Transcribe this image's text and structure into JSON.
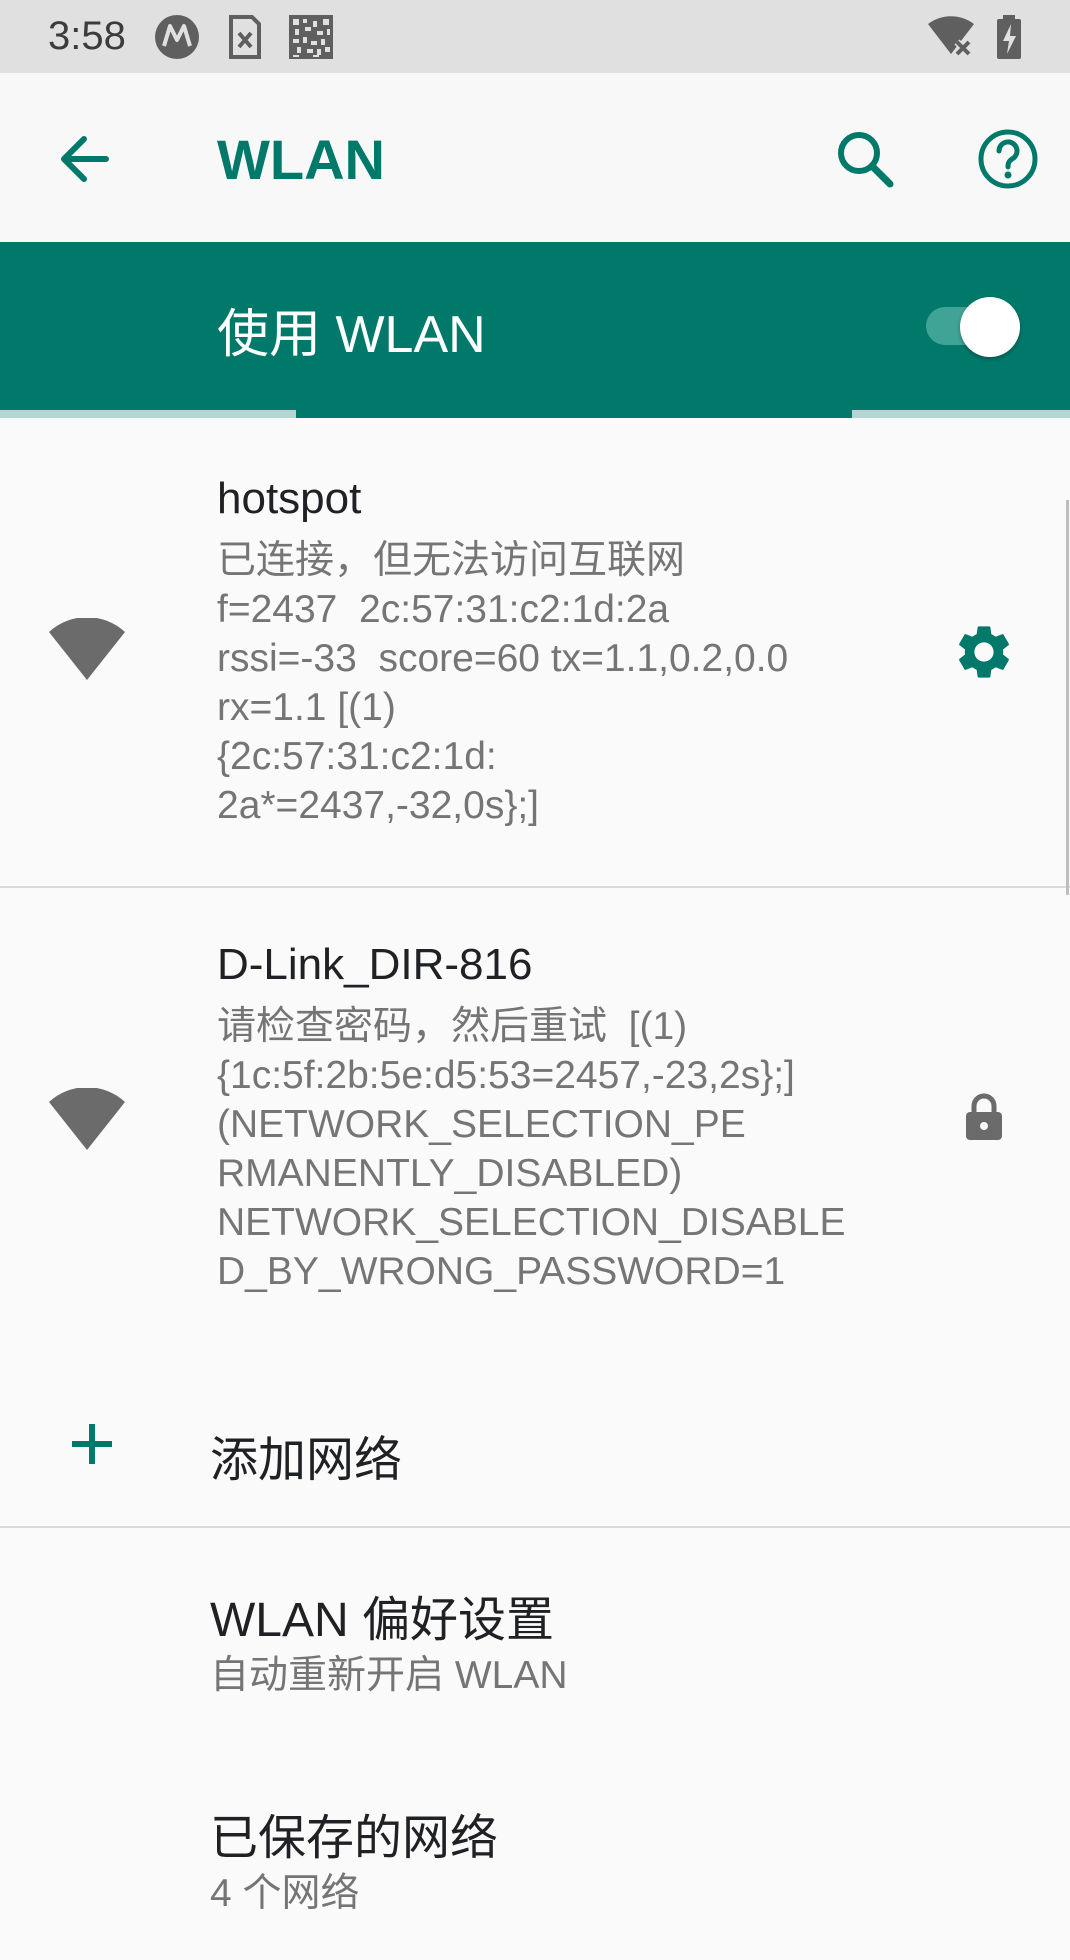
{
  "status_bar": {
    "time": "3:58",
    "icons": [
      "motorola-icon",
      "sim-icon",
      "qr-code-icon",
      "wifi-no-internet-icon",
      "battery-charging-icon"
    ]
  },
  "app_bar": {
    "title": "WLAN",
    "icons": [
      "back-arrow-icon",
      "search-icon",
      "help-icon"
    ]
  },
  "master_switch": {
    "label": "使用 WLAN",
    "enabled": true
  },
  "networks": [
    {
      "name": "hotspot",
      "detail": "已连接，但无法访问互联网\nf=2437  2c:57:31:c2:1d:2a\nrssi=-33  score=60 tx=1.1,0.2,0.0\nrx=1.1 [(1)\n{2c:57:31:c2:1d:\n2a*=2437,-32,0s};]",
      "action_icon": "settings-gear-icon",
      "signal_icon": "wifi-signal-icon"
    },
    {
      "name": "D-Link_DIR-816",
      "detail": "请检查密码，然后重试  [(1)\n{1c:5f:2b:5e:d5:53=2457,-23,2s};]\n(NETWORK_SELECTION_PE\nRMANENTLY_DISABLED)\nNETWORK_SELECTION_DISABLE\nD_BY_WRONG_PASSWORD=1",
      "action_icon": "lock-icon",
      "signal_icon": "wifi-signal-icon"
    }
  ],
  "add_network": {
    "label": "添加网络",
    "icon": "plus-icon"
  },
  "preferences": [
    {
      "title": "WLAN 偏好设置",
      "subtitle": "自动重新开启 WLAN"
    },
    {
      "title": "已保存的网络",
      "subtitle": "4 个网络"
    }
  ],
  "colors": {
    "accent": "#00796b",
    "status_bar": "#e0e0e0",
    "background": "#fafafa",
    "secondary_text": "#757575",
    "icon_gray": "#6b6b6b"
  }
}
